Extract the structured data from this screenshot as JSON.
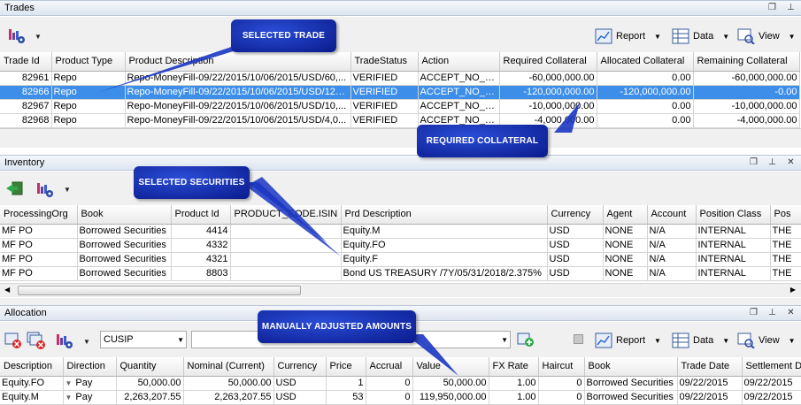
{
  "trades": {
    "title": "Trades",
    "toolbar": {
      "report": "Report",
      "data": "Data",
      "view": "View"
    },
    "columns": [
      "Trade Id",
      "Product Type",
      "Product Description",
      "TradeStatus",
      "Action",
      "Required Collateral",
      "Allocated Collateral",
      "Remaining Collateral"
    ],
    "rows": [
      [
        "82961",
        "Repo",
        "Repo-MoneyFill-09/22/2015/10/06/2015/USD/60,...",
        "VERIFIED",
        "ACCEPT_NO_SDI",
        "-60,000,000.00",
        "0.00",
        "-60,000,000.00"
      ],
      [
        "82966",
        "Repo",
        "Repo-MoneyFill-09/22/2015/10/06/2015/USD/120...",
        "VERIFIED",
        "ACCEPT_NO_SDI",
        "-120,000,000.00",
        "-120,000,000.00",
        "-0.00"
      ],
      [
        "82967",
        "Repo",
        "Repo-MoneyFill-09/22/2015/10/06/2015/USD/10,...",
        "VERIFIED",
        "ACCEPT_NO_SDI",
        "-10,000,000.00",
        "0.00",
        "-10,000,000.00"
      ],
      [
        "82968",
        "Repo",
        "Repo-MoneyFill-09/22/2015/10/06/2015/USD/4,0...",
        "VERIFIED",
        "ACCEPT_NO_SDI",
        "-4,000,000.00",
        "0.00",
        "-4,000,000.00"
      ]
    ]
  },
  "inventory": {
    "title": "Inventory",
    "columns": [
      "ProcessingOrg",
      "Book",
      "Product Id",
      "PRODUCT_CODE.ISIN",
      "Prd Description",
      "Currency",
      "Agent",
      "Account",
      "Position Class",
      "Pos"
    ],
    "rows": [
      [
        "MF PO",
        "Borrowed Securities",
        "4414",
        "",
        "Equity.M",
        "USD",
        "NONE",
        "N/A",
        "INTERNAL",
        "THE"
      ],
      [
        "MF PO",
        "Borrowed Securities",
        "4332",
        "",
        "Equity.FO",
        "USD",
        "NONE",
        "N/A",
        "INTERNAL",
        "THE"
      ],
      [
        "MF PO",
        "Borrowed Securities",
        "4321",
        "",
        "Equity.F",
        "USD",
        "NONE",
        "N/A",
        "INTERNAL",
        "THE"
      ],
      [
        "MF PO",
        "Borrowed Securities",
        "8803",
        "",
        "Bond US TREASURY /7Y/05/31/2018/2.375%",
        "USD",
        "NONE",
        "N/A",
        "INTERNAL",
        "THE"
      ]
    ]
  },
  "allocation": {
    "title": "Allocation",
    "combo_value": "CUSIP",
    "toolbar": {
      "report": "Report",
      "data": "Data",
      "view": "View"
    },
    "columns": [
      "Description",
      "Direction",
      "Quantity",
      "Nominal (Current)",
      "Currency",
      "Price",
      "Accrual",
      "Value",
      "FX Rate",
      "Haircut",
      "Book",
      "Trade Date",
      "Settlement D"
    ],
    "rows": [
      [
        "Equity.FO",
        "Pay",
        "50,000.00",
        "50,000.00",
        "USD",
        "1",
        "0",
        "50,000.00",
        "1.00",
        "0",
        "Borrowed Securities",
        "09/22/2015",
        "09/22/2015"
      ],
      [
        "Equity.M",
        "Pay",
        "2,263,207.55",
        "2,263,207.55",
        "USD",
        "53",
        "0",
        "119,950,000.00",
        "1.00",
        "0",
        "Borrowed Securities",
        "09/22/2015",
        "09/22/2015"
      ]
    ]
  },
  "callouts": {
    "selected_trade": "SELECTED TRADE",
    "required_collateral": "REQUIRED COLLATERAL",
    "selected_securities": "SELECTED SECURITIES",
    "manually_adjusted": "MANUALLY ADJUSTED AMOUNTS"
  },
  "icons": {
    "pin": "pin-icon",
    "restore": "restore-icon",
    "close": "close-icon",
    "chart_gear": "chart-gear-icon",
    "report": "report-icon",
    "data": "data-icon",
    "view": "view-icon"
  }
}
